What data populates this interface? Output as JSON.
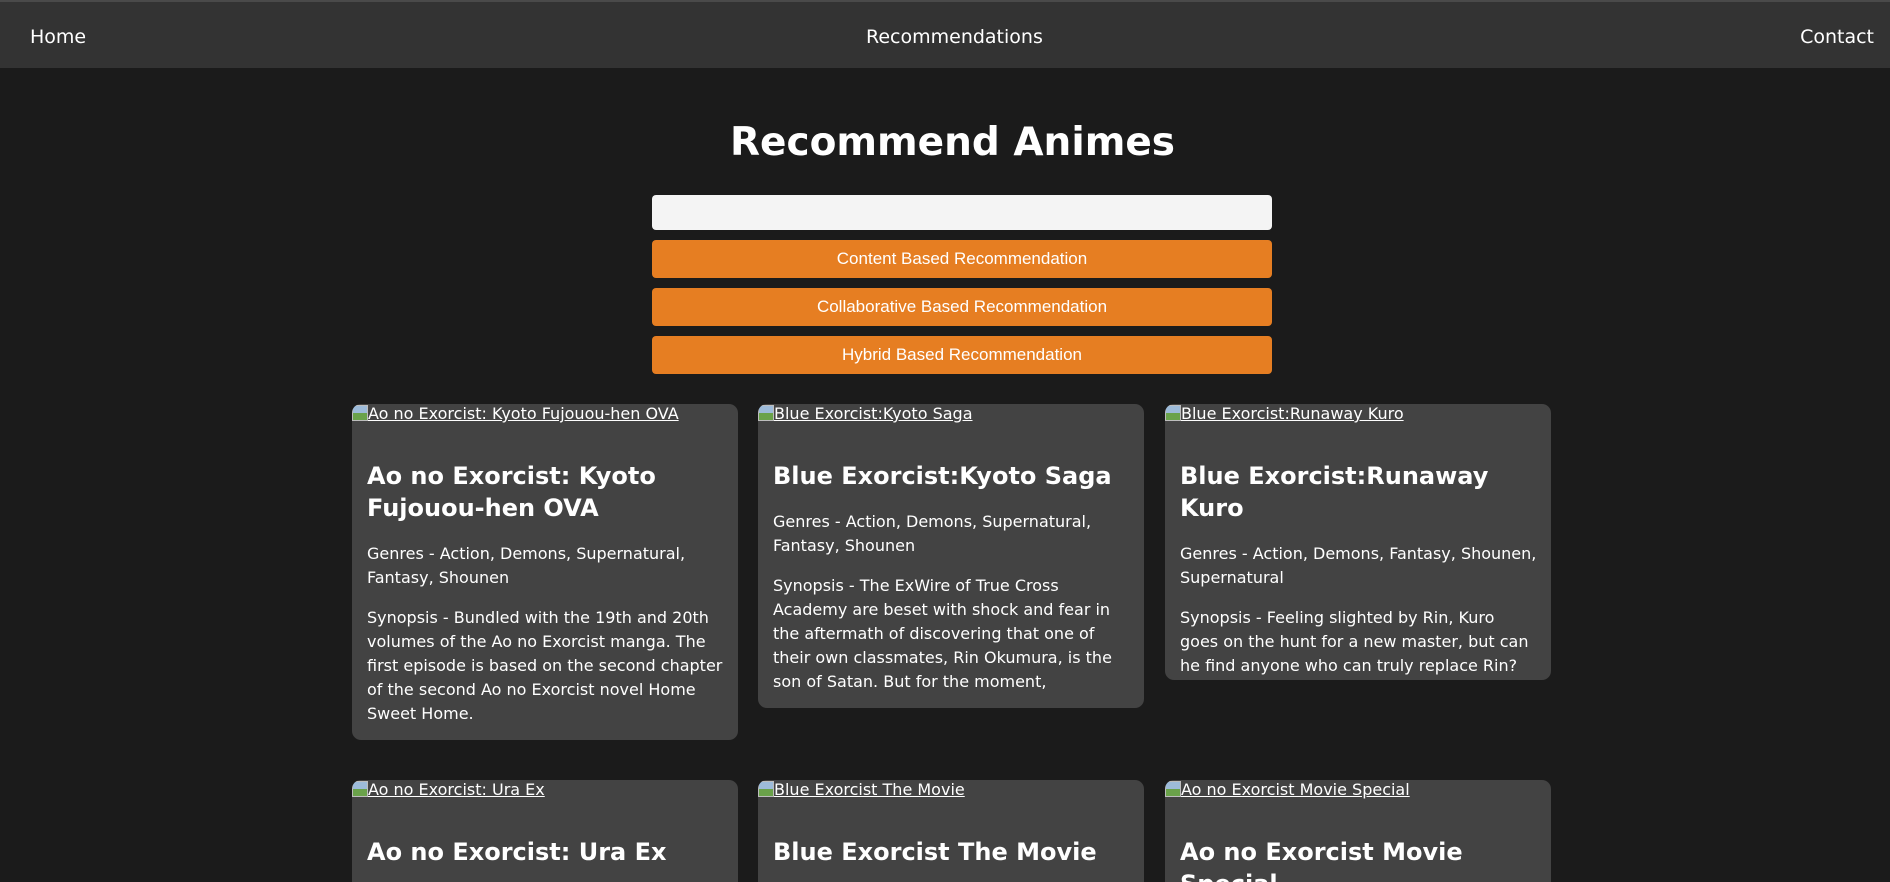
{
  "nav": {
    "home": "Home",
    "recommendations": "Recommendations",
    "contact": "Contact"
  },
  "main": {
    "title": "Recommend Animes",
    "search_value": "",
    "buttons": {
      "content": "Content Based Recommendation",
      "collaborative": "Collaborative Based Recommendation",
      "hybrid": "Hybrid Based Recommendation"
    }
  },
  "cards": [
    {
      "img_alt": "Ao no Exorcist: Kyoto Fujouou-hen OVA",
      "title": "Ao no Exorcist: Kyoto Fujouou-hen OVA",
      "genres": "Genres - Action, Demons, Supernatural, Fantasy, Shounen",
      "synopsis": "Synopsis - Bundled with the 19th and 20th volumes of the Ao no Exorcist manga. The first episode is based on the second chapter of the second Ao no Exorcist novel Home Sweet Home."
    },
    {
      "img_alt": "Blue Exorcist:Kyoto Saga",
      "title": "Blue Exorcist:Kyoto Saga",
      "genres": "Genres - Action, Demons, Supernatural, Fantasy, Shounen",
      "synopsis": "Synopsis - The ExWire of True Cross Academy are beset with shock and fear in the aftermath of discovering that one of their own classmates, Rin Okumura, is the son of Satan. But for the moment,"
    },
    {
      "img_alt": "Blue Exorcist:Runaway Kuro",
      "title": "Blue Exorcist:Runaway Kuro",
      "genres": "Genres - Action, Demons, Fantasy, Shounen, Supernatural",
      "synopsis": "Synopsis - Feeling slighted by Rin, Kuro goes on the hunt for a new master, but can he find anyone who can truly replace Rin?"
    },
    {
      "img_alt": "Ao no Exorcist: Ura Ex",
      "title": "Ao no Exorcist: Ura Ex"
    },
    {
      "img_alt": "Blue Exorcist The Movie",
      "title": "Blue Exorcist The Movie"
    },
    {
      "img_alt": "Ao no Exorcist Movie Special",
      "title": "Ao no Exorcist Movie Special"
    }
  ]
}
